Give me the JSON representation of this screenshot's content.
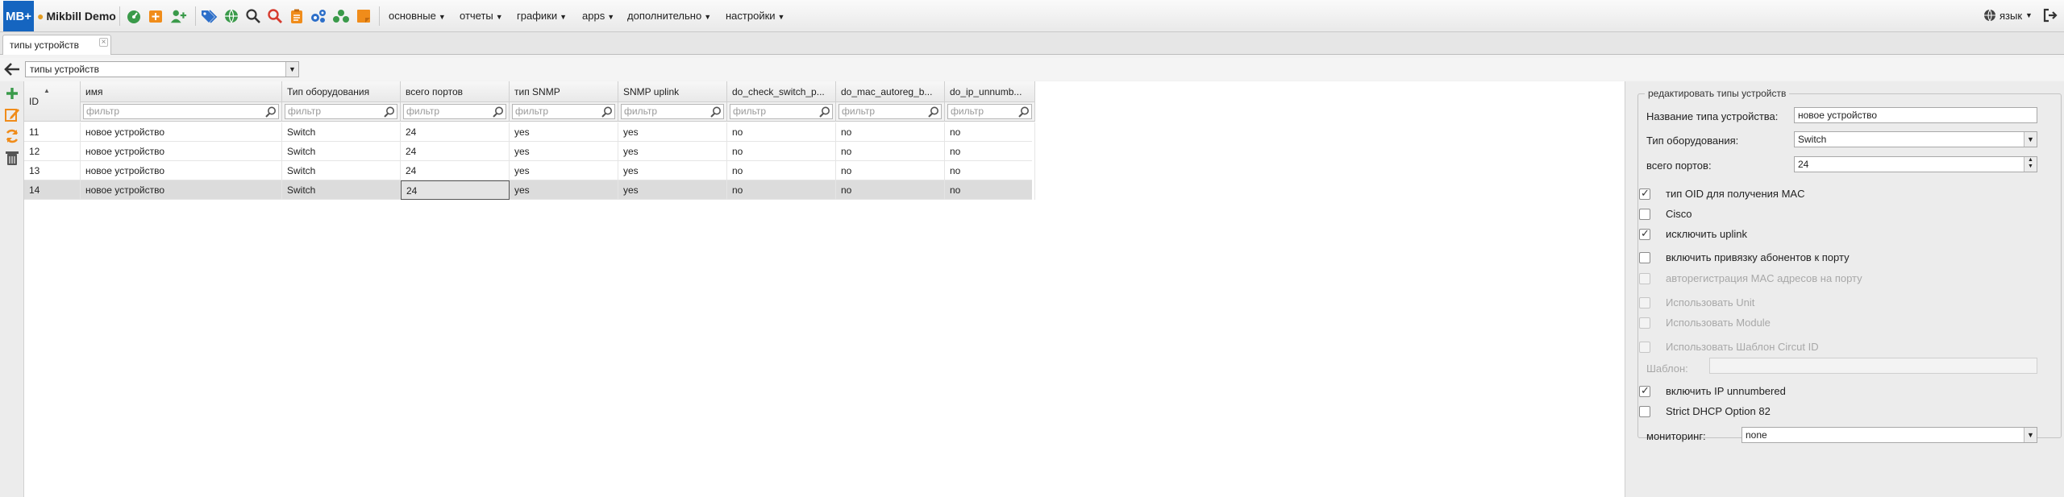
{
  "app": {
    "logo": "MB+",
    "brand": "Mikbill Demo"
  },
  "menu": [
    {
      "label": "основные"
    },
    {
      "label": "отчеты"
    },
    {
      "label": "графики"
    },
    {
      "label": "apps"
    },
    {
      "label": "дополнительно"
    },
    {
      "label": "настройки"
    }
  ],
  "lang": {
    "label": "язык"
  },
  "tab": {
    "label": "типы устройств"
  },
  "selector": {
    "value": "типы устройств"
  },
  "grid": {
    "columns": [
      {
        "label": "ID"
      },
      {
        "label": "имя"
      },
      {
        "label": "Тип оборудования"
      },
      {
        "label": "всего портов"
      },
      {
        "label": "тип SNMP"
      },
      {
        "label": "SNMP uplink"
      },
      {
        "label": "do_check_switch_p..."
      },
      {
        "label": "do_mac_autoreg_b..."
      },
      {
        "label": "do_ip_unnumb..."
      }
    ],
    "filter_placeholder": "фильтр",
    "rows": [
      {
        "cells": [
          "11",
          "новое устройство",
          "Switch",
          "24",
          "yes",
          "yes",
          "no",
          "no",
          "no"
        ]
      },
      {
        "cells": [
          "12",
          "новое устройство",
          "Switch",
          "24",
          "yes",
          "yes",
          "no",
          "no",
          "no"
        ]
      },
      {
        "cells": [
          "13",
          "новое устройство",
          "Switch",
          "24",
          "yes",
          "yes",
          "no",
          "no",
          "no"
        ]
      },
      {
        "cells": [
          "14",
          "новое устройство",
          "Switch",
          "24",
          "yes",
          "yes",
          "no",
          "no",
          "no"
        ]
      }
    ]
  },
  "form": {
    "legend": "редактировать типы устройств",
    "name_label": "Название типа устройства:",
    "name_value": "новое устройство",
    "type_label": "Тип оборудования:",
    "type_value": "Switch",
    "ports_label": "всего портов:",
    "ports_value": "24",
    "checks": [
      {
        "label": "тип OID для получения MAC",
        "checked": true,
        "disabled": false
      },
      {
        "label": "Cisco",
        "checked": false,
        "disabled": false
      },
      {
        "label": "исключить uplink",
        "checked": true,
        "disabled": false
      },
      {
        "label": "включить привязку абонентов к порту",
        "checked": false,
        "disabled": false
      },
      {
        "label": "авторегистрация MAC адресов на порту",
        "checked": false,
        "disabled": true
      },
      {
        "label": "Использовать Unit",
        "checked": false,
        "disabled": true
      },
      {
        "label": "Использовать Module",
        "checked": false,
        "disabled": true
      },
      {
        "label": "Использовать Шаблон Circut ID",
        "checked": false,
        "disabled": true
      }
    ],
    "template_label": "Шаблон:",
    "template_value": "",
    "checks2": [
      {
        "label": "включить IP unnumbered",
        "checked": true,
        "disabled": false
      },
      {
        "label": "Strict DHCP Option 82",
        "checked": false,
        "disabled": false
      }
    ],
    "monitoring_label": "мониторинг:",
    "monitoring_value": "none"
  }
}
